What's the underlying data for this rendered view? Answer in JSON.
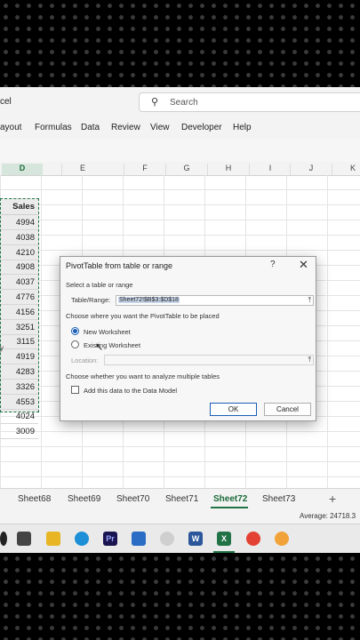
{
  "app": {
    "title_fragment": "cel"
  },
  "search": {
    "placeholder": "Search",
    "icon": "search-icon"
  },
  "menu": [
    "ayout",
    "Formulas",
    "Data",
    "Review",
    "View",
    "Developer",
    "Help"
  ],
  "columns": [
    "D",
    "E",
    "F",
    "G",
    "H",
    "I",
    "J",
    "K"
  ],
  "sales": {
    "header": "Sales",
    "values": [
      "4994",
      "4038",
      "4210",
      "4908",
      "4037",
      "4776",
      "4156",
      "3251",
      "3115",
      "4919",
      "4283",
      "3326",
      "4553",
      "4024",
      "3009"
    ]
  },
  "left_fragment": "y",
  "sheets": [
    "Sheet68",
    "Sheet69",
    "Sheet70",
    "Sheet71",
    "Sheet72",
    "Sheet73"
  ],
  "active_sheet": "Sheet72",
  "add_sheet": "+",
  "status": {
    "average": "Average: 24718.3"
  },
  "dialog": {
    "title": "PivotTable from table or range",
    "help": "?",
    "close": "✕",
    "select_label": "Select a table or range",
    "range_label": "Table/Range:",
    "range_value": "Sheet72!$B$3:$D$18",
    "placement_label": "Choose where you want the PivotTable to be placed",
    "new_worksheet": "New Worksheet",
    "existing_worksheet": "Existing Worksheet",
    "location_label": "Location:",
    "multiple_label": "Choose whether you want to analyze multiple tables",
    "data_model_label": "Add this data to the Data Model",
    "ok": "OK",
    "cancel": "Cancel",
    "selected_option": "New Worksheet"
  },
  "colors": {
    "excel_green": "#217346",
    "accent_blue": "#1a5fb4"
  }
}
